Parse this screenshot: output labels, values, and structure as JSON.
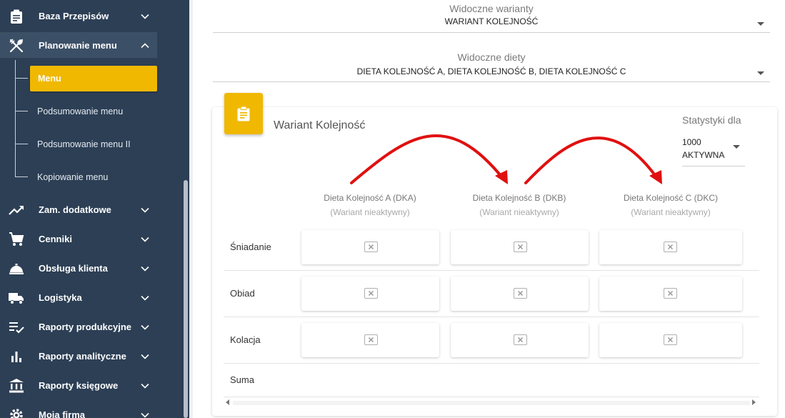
{
  "sidebar": {
    "items": [
      {
        "label": "Baza Przepisów",
        "icon": "clipboard-icon",
        "state": "collapsed"
      },
      {
        "label": "Planowanie menu",
        "icon": "utensils-icon",
        "state": "expanded"
      },
      {
        "label": "Zam. dodatkowe",
        "icon": "trending-up-icon",
        "state": "collapsed"
      },
      {
        "label": "Cenniki",
        "icon": "cart-icon",
        "state": "collapsed"
      },
      {
        "label": "Obsługa klienta",
        "icon": "service-bell-icon",
        "state": "collapsed"
      },
      {
        "label": "Logistyka",
        "icon": "truck-icon",
        "state": "collapsed"
      },
      {
        "label": "Raporty produkcyjne",
        "icon": "checklist-icon",
        "state": "collapsed"
      },
      {
        "label": "Raporty analityczne",
        "icon": "bar-chart-icon",
        "state": "collapsed"
      },
      {
        "label": "Raporty księgowe",
        "icon": "bank-icon",
        "state": "collapsed"
      },
      {
        "label": "Moja firma",
        "icon": "gear-icon",
        "state": "collapsed"
      }
    ],
    "subitems": [
      {
        "label": "Menu",
        "active": true
      },
      {
        "label": "Podsumowanie menu",
        "active": false
      },
      {
        "label": "Podsumowanie menu II",
        "active": false
      },
      {
        "label": "Kopiowanie menu",
        "active": false
      }
    ],
    "active_color": "#f0b800",
    "background": "#2c3f55"
  },
  "filters": {
    "variants": {
      "label": "Widoczne warianty",
      "value": "WARIANT KOLEJNOŚĆ"
    },
    "diets": {
      "label": "Widoczne diety",
      "value": "DIETA KOLEJNOŚĆ A, DIETA KOLEJNOŚĆ B, DIETA KOLEJNOŚĆ C"
    }
  },
  "card": {
    "icon": "clipboard-icon",
    "title": "Wariant Kolejność",
    "stats": {
      "label": "Statystyki dla",
      "value_line1": "1000",
      "value_line2": "AKTYWNA"
    },
    "columns": [
      {
        "name": "Dieta Kolejność A (DKA)",
        "status": "(Wariant nieaktywny)"
      },
      {
        "name": "Dieta Kolejność B (DKB)",
        "status": "(Wariant nieaktywny)"
      },
      {
        "name": "Dieta Kolejność C (DKC)",
        "status": "(Wariant nieaktywny)"
      }
    ],
    "rows": [
      {
        "label": "Śniadanie"
      },
      {
        "label": "Obiad"
      },
      {
        "label": "Kolacja"
      }
    ],
    "sum_label": "Suma",
    "annotation_color": "#e01010"
  }
}
